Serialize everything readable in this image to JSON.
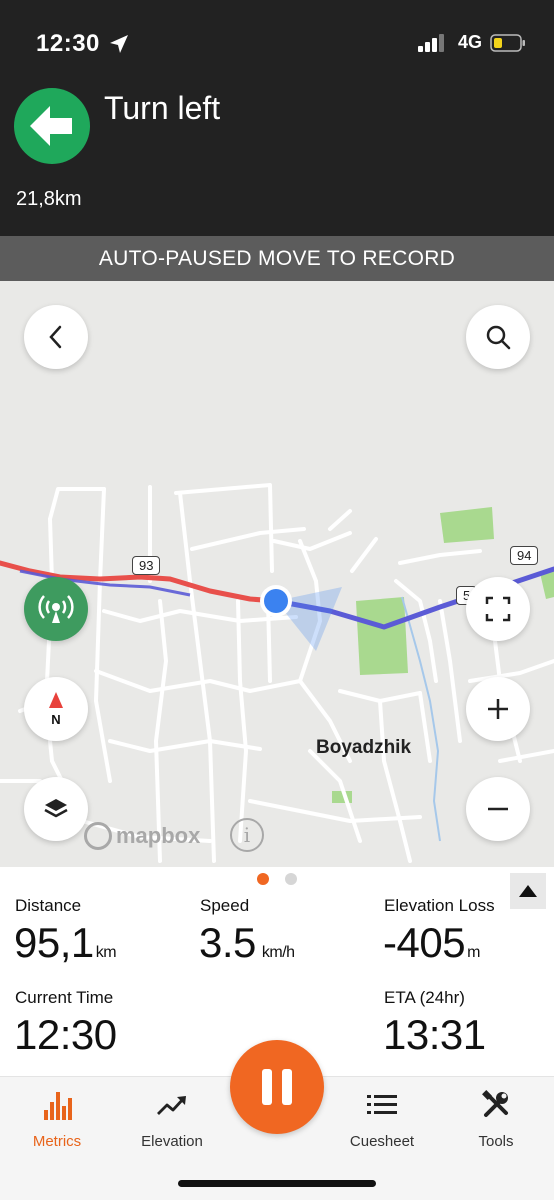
{
  "status_bar": {
    "time": "12:30",
    "network": "4G"
  },
  "navigation": {
    "instruction": "Turn left",
    "distance": "21,8km",
    "turn_color": "#1fa85b"
  },
  "banner": {
    "text": "AUTO-PAUSED MOVE TO RECORD"
  },
  "map": {
    "place_label": "Boyadzhik",
    "road_labels": [
      "93",
      "94",
      "5"
    ],
    "attribution": "mapbox",
    "buttons": [
      "back-icon",
      "search-icon",
      "live-broadcast-icon",
      "compass-icon",
      "layers-icon",
      "fullscreen-icon",
      "zoom-in-icon",
      "zoom-out-icon"
    ],
    "compass_letter": "N",
    "route_colors": {
      "done": "#e8504b",
      "ahead": "#5b5bd6"
    }
  },
  "metrics": {
    "page_dots": {
      "count": 2,
      "active": 0
    },
    "distance": {
      "label": "Distance",
      "value": "95,1",
      "unit": "km"
    },
    "speed": {
      "label": "Speed",
      "value": "3.5",
      "unit": "km/h"
    },
    "elevation_loss": {
      "label": "Elevation Loss",
      "value": "-405",
      "unit": "m"
    },
    "current_time": {
      "label": "Current Time",
      "value": "12:30"
    },
    "eta": {
      "label": "ETA (24hr)",
      "value": "13:31"
    }
  },
  "tabs": [
    {
      "label": "Metrics",
      "icon": "bar-chart-icon",
      "active": true
    },
    {
      "label": "Elevation",
      "icon": "trend-up-icon",
      "active": false
    },
    {
      "label": "Cuesheet",
      "icon": "list-icon",
      "active": false
    },
    {
      "label": "Tools",
      "icon": "tools-icon",
      "active": false
    }
  ],
  "accent_color": "#f06722"
}
